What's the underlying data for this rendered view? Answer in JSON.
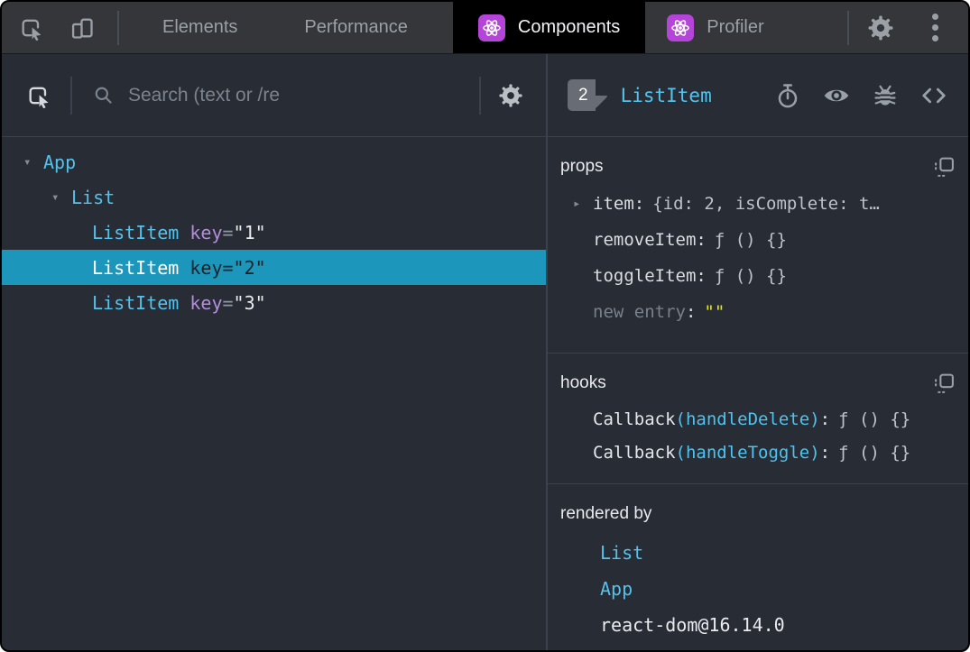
{
  "topbar": {
    "tabs": [
      {
        "label": "Elements",
        "active": false
      },
      {
        "label": "Performance",
        "active": false
      },
      {
        "label": "Components",
        "active": true
      },
      {
        "label": "Profiler",
        "active": false
      }
    ]
  },
  "search": {
    "placeholder": "Search (text or /re"
  },
  "tree": {
    "rows": [
      {
        "arrow": "▾",
        "name": "App"
      },
      {
        "arrow": "▾",
        "name": "List"
      },
      {
        "name": "ListItem",
        "attr": "key",
        "eq": "=",
        "value": "\"1\""
      },
      {
        "name": "ListItem",
        "attr": "key",
        "eq": "=",
        "value": "\"2\"",
        "selected": true
      },
      {
        "name": "ListItem",
        "attr": "key",
        "eq": "=",
        "value": "\"3\""
      }
    ]
  },
  "inspected": {
    "badge": "2",
    "title": "ListItem"
  },
  "props": {
    "label": "props",
    "rows": [
      {
        "arrow": "▸",
        "name": "item",
        "colon": ":",
        "value": "{id: 2, isComplete: t…"
      },
      {
        "name": "removeItem",
        "colon": ":",
        "value": "ƒ () {}"
      },
      {
        "name": "toggleItem",
        "colon": ":",
        "value": "ƒ () {}"
      },
      {
        "name": "new entry",
        "colon": ":",
        "value": "\"\""
      }
    ]
  },
  "hooks": {
    "label": "hooks",
    "rows": [
      {
        "fn": "Callback",
        "arg": "(handleDelete)",
        "colon": ":",
        "value": "ƒ () {}"
      },
      {
        "fn": "Callback",
        "arg": "(handleToggle)",
        "colon": ":",
        "value": "ƒ () {}"
      }
    ]
  },
  "rendered_by": {
    "label": "rendered by",
    "owners": [
      {
        "name": "List"
      },
      {
        "name": "App"
      },
      {
        "name": "react-dom@16.14.0"
      }
    ]
  },
  "icons": {
    "inspect": "cursor-in-box",
    "device_toolbar": "phone-and-tablet",
    "search": "magnifier",
    "settings": "gear",
    "menu": "three-vertical-dots",
    "react": "atom-on-purple-tile",
    "suspend": "stopwatch",
    "inspect_dom": "eye",
    "log_component": "bug",
    "view_source": "angle-brackets",
    "copy": "copy-square-dotted"
  },
  "colors": {
    "panel_bg": "#282c34",
    "topbar_bg": "#343639",
    "active_tab_bg": "#000000",
    "selection": "#1d96bc",
    "component_cyan": "#56c2ec",
    "attr_purple": "#b48ddb",
    "value_gray": "#bdc2ca",
    "new_entry_yellow": "#e5e510",
    "icon_gray": "#9aa0a8",
    "react_purple": "#b545d9",
    "divider": "#3c414b"
  }
}
